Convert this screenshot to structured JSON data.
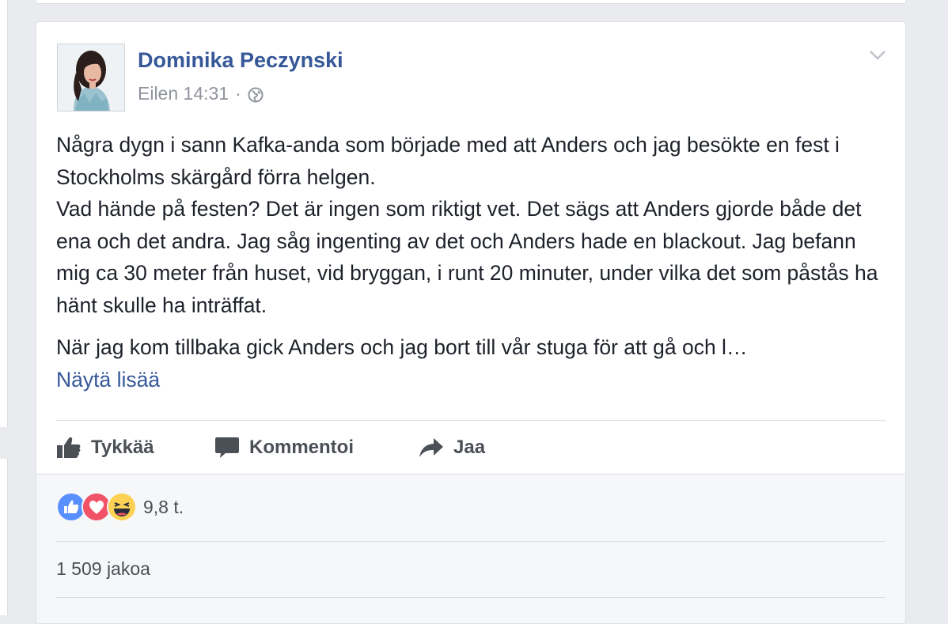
{
  "post": {
    "author": "Dominika Peczynski",
    "time": "Eilen 14:31",
    "separator": "·",
    "privacy_icon": "globe-icon",
    "paragraph1": "Några dygn i sann Kafka-anda som började med att Anders och jag besökte en fest i Stockholms skärgård förra helgen.\nVad hände på festen? Det är ingen som riktigt vet. Det sägs att Anders gjorde både det ena och det andra. Jag såg ingenting av det och Anders hade en blackout. Jag befann mig ca 30 meter från huset, vid bryggan, i runt 20 minuter, under vilka det som påstås ha hänt skulle ha inträffat.",
    "paragraph2": "När jag kom tillbaka gick Anders och jag bort till vår stuga för att gå och l…",
    "see_more": "Näytä lisää"
  },
  "actions": {
    "like": "Tykkää",
    "comment": "Kommentoi",
    "share": "Jaa"
  },
  "footer": {
    "reactions": [
      "like",
      "love",
      "haha"
    ],
    "reaction_count": "9,8 t.",
    "shares": "1 509 jakoa"
  },
  "colors": {
    "link": "#365899",
    "background": "#e9ebee",
    "like_blue": "#5890ff",
    "love_red": "#f25268",
    "haha_yellow": "#fcd154"
  }
}
